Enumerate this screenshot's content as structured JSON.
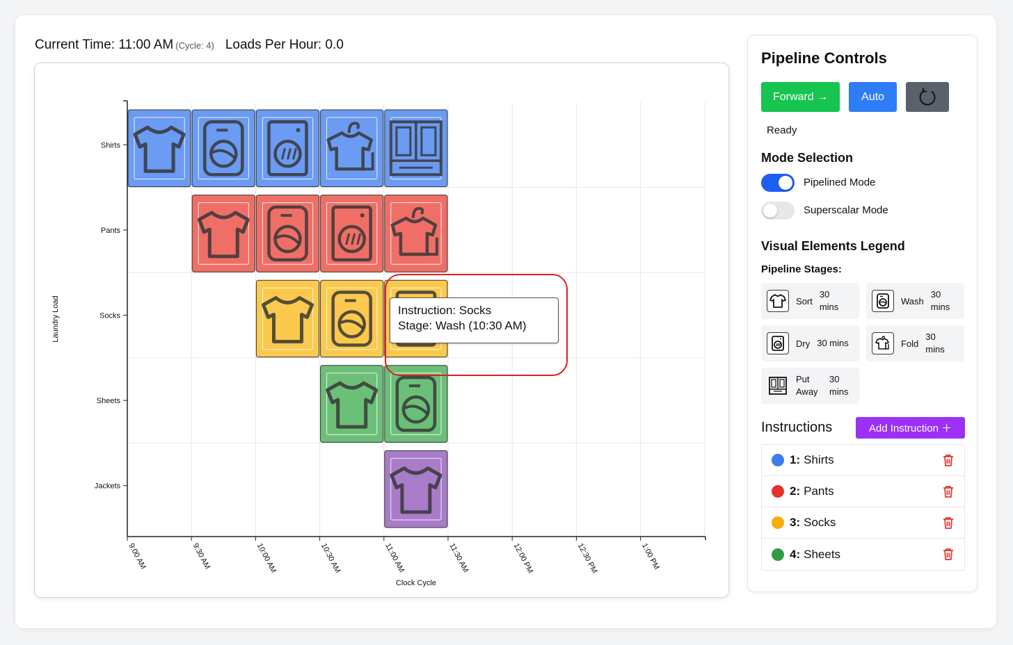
{
  "status": {
    "current_time_label": "Current Time: 11:00 AM",
    "cycle_label": "(Cycle: 4)",
    "loads_per_hour_label": "Loads Per Hour: 0.0"
  },
  "chart_data": {
    "type": "scatter",
    "xlabel": "Clock Cycle",
    "ylabel": "Laundry Load",
    "x_ticks": [
      "9:00 AM",
      "9:30 AM",
      "10:00 AM",
      "10:30 AM",
      "11:00 AM",
      "11:30 AM",
      "12:00 PM",
      "12:30 PM",
      "1:00 PM"
    ],
    "categories": [
      "Shirts",
      "Pants",
      "Socks",
      "Sheets",
      "Jackets"
    ],
    "stages": [
      "Sort",
      "Wash",
      "Dry",
      "Fold",
      "Put Away"
    ],
    "series": [
      {
        "name": "Shirts",
        "color": "#6b9bf2",
        "start_cycle": 0,
        "stages_shown": [
          "Sort",
          "Wash",
          "Dry",
          "Fold",
          "Put Away"
        ]
      },
      {
        "name": "Pants",
        "color": "#ef6f66",
        "start_cycle": 1,
        "stages_shown": [
          "Sort",
          "Wash",
          "Dry",
          "Fold"
        ]
      },
      {
        "name": "Socks",
        "color": "#fbc94d",
        "start_cycle": 2,
        "stages_shown": [
          "Sort",
          "Wash",
          "Dry"
        ]
      },
      {
        "name": "Sheets",
        "color": "#6cbf78",
        "start_cycle": 3,
        "stages_shown": [
          "Sort",
          "Wash"
        ]
      },
      {
        "name": "Jackets",
        "color": "#a87cc8",
        "start_cycle": 4,
        "stages_shown": [
          "Sort"
        ]
      }
    ],
    "grid": true
  },
  "tooltip": {
    "line1": "Instruction: Socks",
    "line2": "Stage: Wash (10:30 AM)"
  },
  "panel": {
    "title": "Pipeline Controls",
    "forward_label": "Forward →",
    "auto_label": "Auto",
    "status": "Ready",
    "mode_title": "Mode Selection",
    "pipelined_label": "Pipelined Mode",
    "superscalar_label": "Superscalar Mode",
    "pipelined_on": true,
    "superscalar_on": false,
    "legend_title": "Visual Elements Legend",
    "stages_title": "Pipeline Stages:",
    "stages": [
      {
        "name": "Sort",
        "time": "30 mins"
      },
      {
        "name": "Wash",
        "time": "30 mins"
      },
      {
        "name": "Dry",
        "time": "30 mins"
      },
      {
        "name": "Fold",
        "time": "30 mins"
      },
      {
        "name": "Put Away",
        "time": "30 mins"
      }
    ],
    "instructions_title": "Instructions",
    "add_label": "Add Instruction ＋",
    "instructions": [
      {
        "num": "1:",
        "name": "Shirts",
        "color": "#3b7df0"
      },
      {
        "num": "2:",
        "name": "Pants",
        "color": "#e2332b"
      },
      {
        "num": "3:",
        "name": "Socks",
        "color": "#f6ad0c"
      },
      {
        "num": "4:",
        "name": "Sheets",
        "color": "#2e9c47"
      }
    ]
  }
}
